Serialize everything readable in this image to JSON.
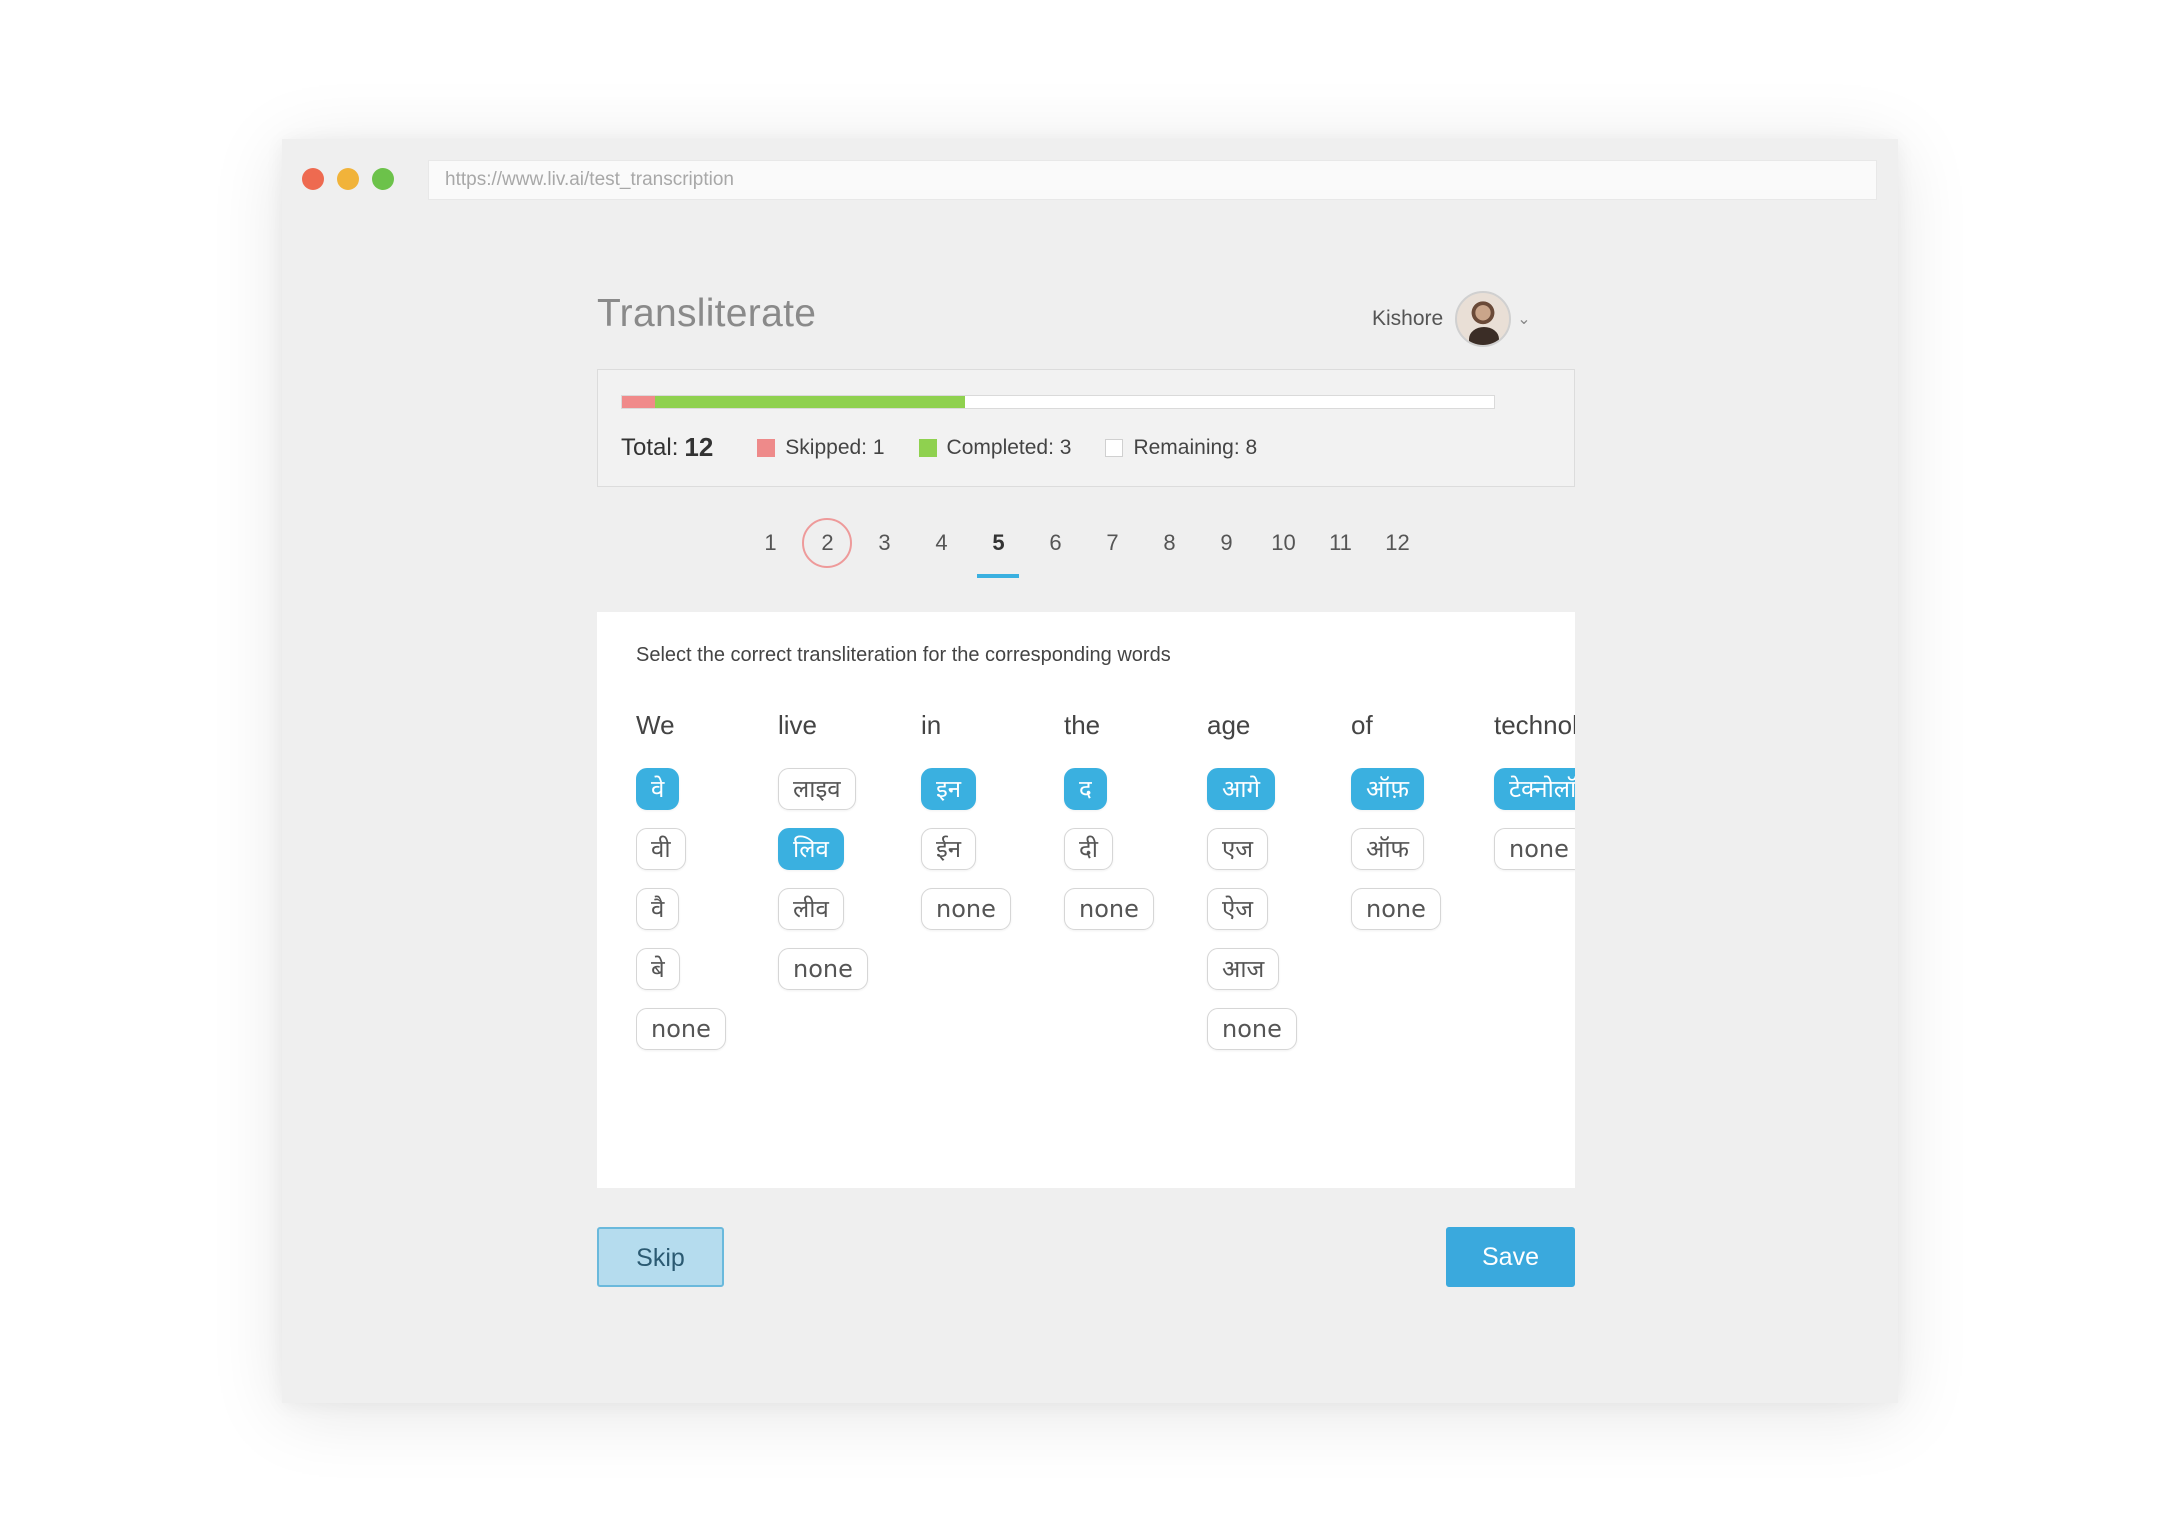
{
  "browser": {
    "url": "https://www.liv.ai/test_transcription"
  },
  "header": {
    "title": "Transliterate",
    "user_name": "Kishore"
  },
  "progress": {
    "total_label": "Total:",
    "total_value": "12",
    "skipped_label": "Skipped: 1",
    "completed_label": "Completed: 3",
    "remaining_label": "Remaining: 8",
    "skipped_fraction": 0.038,
    "completed_fraction": 0.355,
    "colors": {
      "skipped": "#ee8a8a",
      "completed": "#8fd14f",
      "remaining": "#ffffff"
    }
  },
  "pager": {
    "pages": [
      "1",
      "2",
      "3",
      "4",
      "5",
      "6",
      "7",
      "8",
      "9",
      "10",
      "11",
      "12"
    ],
    "skipped_page": "2",
    "active_page": "5"
  },
  "panel": {
    "instruction": "Select the correct transliteration for the corresponding words",
    "words": [
      {
        "word": "We",
        "options": [
          "वे",
          "वी",
          "वै",
          "बे",
          "none"
        ],
        "selected": 0
      },
      {
        "word": "live",
        "options": [
          "लाइव",
          "लिव",
          "लीव",
          "none"
        ],
        "selected": 1
      },
      {
        "word": "in",
        "options": [
          "इन",
          "ईन",
          "none"
        ],
        "selected": 0
      },
      {
        "word": "the",
        "options": [
          "द",
          "दी",
          "none"
        ],
        "selected": 0
      },
      {
        "word": "age",
        "options": [
          "आगे",
          "एज",
          "ऐज",
          "आज",
          "none"
        ],
        "selected": 0
      },
      {
        "word": "of",
        "options": [
          "ऑफ़",
          "ऑफ",
          "none"
        ],
        "selected": 0
      },
      {
        "word": "technology",
        "options": [
          "टेक्नोलॉजी",
          "none"
        ],
        "selected": 0
      }
    ],
    "scroll_fraction": 0.75
  },
  "actions": {
    "skip_label": "Skip",
    "save_label": "Save"
  },
  "colors": {
    "accent": "#3ab0e0",
    "skip_button": "#b5dcee"
  }
}
